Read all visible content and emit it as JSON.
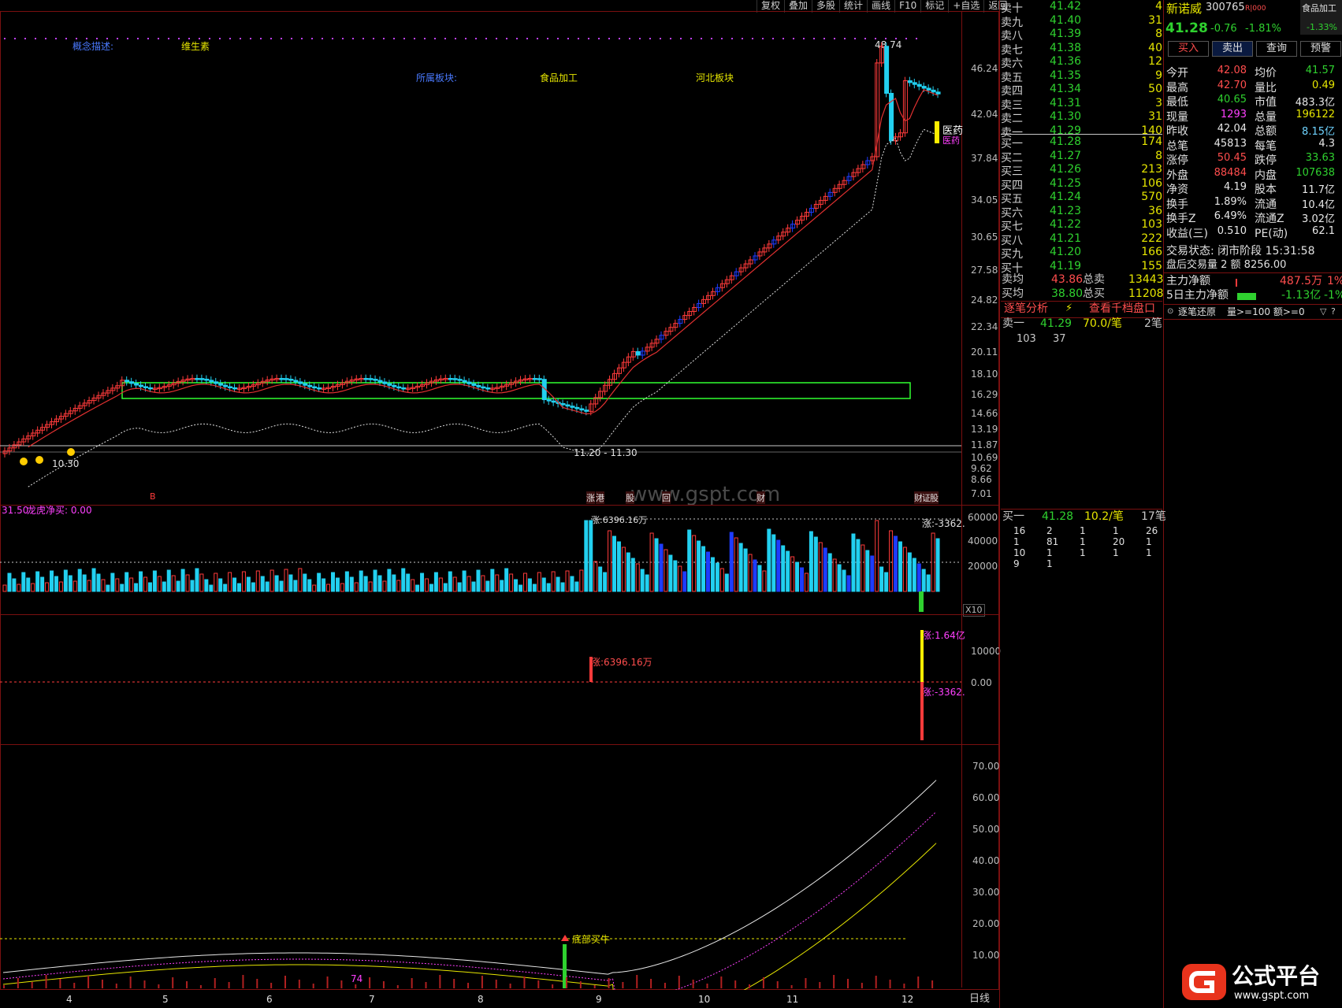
{
  "toolbar": [
    "复权",
    "叠加",
    "多股",
    "统计",
    "画线",
    "F10",
    "标记",
    "+自选",
    "返回"
  ],
  "chart_info": {
    "concept_label": "概念描述:",
    "concept_value": "维生素",
    "sector_label": "所属板块:",
    "sector_value": "食品加工",
    "region_value": "河北板块",
    "peak_label": "48.74",
    "range_label_left": "10.30",
    "range_label_mid": "11.20 - 11.30",
    "tag_medicine": "医药",
    "tag_medicine2": "医药",
    "watermark": "www.gspt.com",
    "event_tags": [
      "B",
      "涨",
      "港",
      "股",
      "回",
      "财",
      "财",
      "证",
      "股"
    ],
    "price_axis": [
      "46.24",
      "42.04",
      "37.84",
      "34.05",
      "30.65",
      "27.58",
      "24.82",
      "22.34",
      "20.11",
      "18.10",
      "16.29",
      "14.66",
      "13.19",
      "11.87",
      "10.69",
      "9.62",
      "8.66",
      "7.01"
    ],
    "vol_header_a": "31.50",
    "vol_header_b": "龙虎净买: 0.00",
    "vol_axis": [
      "60000",
      "40000",
      "20000"
    ],
    "vol_annot_left": "涨:6396.16万",
    "vol_annot_right": "涨:-3362.",
    "x10": "X10",
    "flow_axis": [
      "10000",
      "0.00"
    ],
    "flow_annot_left": "涨:6396.16万",
    "flow_annot_right_top": "涨:1.64亿",
    "flow_annot_right_bottom": "涨:-3362.",
    "ind_axis": [
      "70.00",
      "60.00",
      "50.00",
      "40.00",
      "30.00",
      "20.00",
      "10.00"
    ],
    "ind_signal": "底部买牛",
    "ind_74": "74",
    "date_axis": [
      "4",
      "5",
      "6",
      "7",
      "8",
      "9",
      "10",
      "11",
      "12"
    ],
    "period": "日线"
  },
  "orderbook": {
    "sells": [
      {
        "label": "卖十",
        "price": "41.42",
        "vol": "4"
      },
      {
        "label": "卖九",
        "price": "41.40",
        "vol": "31"
      },
      {
        "label": "卖八",
        "price": "41.39",
        "vol": "8"
      },
      {
        "label": "卖七",
        "price": "41.38",
        "vol": "40"
      },
      {
        "label": "卖六",
        "price": "41.36",
        "vol": "12"
      },
      {
        "label": "卖五",
        "price": "41.35",
        "vol": "9"
      },
      {
        "label": "卖四",
        "price": "41.34",
        "vol": "50"
      },
      {
        "label": "卖三",
        "price": "41.31",
        "vol": "3"
      },
      {
        "label": "卖二",
        "price": "41.30",
        "vol": "31"
      },
      {
        "label": "卖一",
        "price": "41.29",
        "vol": "140"
      }
    ],
    "buys": [
      {
        "label": "买一",
        "price": "41.28",
        "vol": "174"
      },
      {
        "label": "买二",
        "price": "41.27",
        "vol": "8"
      },
      {
        "label": "买三",
        "price": "41.26",
        "vol": "213"
      },
      {
        "label": "买四",
        "price": "41.25",
        "vol": "106"
      },
      {
        "label": "买五",
        "price": "41.24",
        "vol": "570"
      },
      {
        "label": "买六",
        "price": "41.23",
        "vol": "36"
      },
      {
        "label": "买七",
        "price": "41.22",
        "vol": "103"
      },
      {
        "label": "买八",
        "price": "41.21",
        "vol": "222"
      },
      {
        "label": "买九",
        "price": "41.20",
        "vol": "166"
      },
      {
        "label": "买十",
        "price": "41.19",
        "vol": "155"
      }
    ],
    "avg_sell_label": "卖均",
    "avg_sell": "43.86",
    "total_sell_label": "总卖",
    "total_sell": "13443",
    "avg_buy_label": "买均",
    "avg_buy": "38.80",
    "total_buy_label": "总买",
    "total_buy": "11208",
    "tab_analysis": "逐笔分析",
    "tab_depth": "查看千档盘口",
    "sell1_label": "卖一",
    "sell1_price": "41.29",
    "sell1_per": "70.0/笔",
    "sell1_count": "2笔",
    "sell1_items": [
      "103",
      "37"
    ],
    "buy1_label": "买一",
    "buy1_price": "41.28",
    "buy1_per": "10.2/笔",
    "buy1_count": "17笔",
    "buy1_grid": [
      [
        "16",
        "2",
        "1",
        "1",
        "26"
      ],
      [
        "1",
        "81",
        "1",
        "20",
        "1"
      ],
      [
        "10",
        "1",
        "1",
        "1",
        "1"
      ],
      [
        "9",
        "1",
        "",
        "",
        ""
      ]
    ]
  },
  "quote": {
    "name": "新诺威",
    "code": "300765",
    "tag": "R|000",
    "sector_badge": "食品加工",
    "sector_pct": "-1.33%",
    "price": "41.28",
    "change": "-0.76",
    "pct": "-1.81%",
    "buttons": [
      "买入",
      "卖出",
      "查询",
      "预警"
    ],
    "rows": [
      [
        {
          "k": "今开",
          "v": "42.08",
          "c": "red"
        },
        {
          "k": "均价",
          "v": "41.57",
          "c": "green"
        }
      ],
      [
        {
          "k": "最高",
          "v": "42.70",
          "c": "red"
        },
        {
          "k": "量比",
          "v": "0.49",
          "c": "yellow"
        }
      ],
      [
        {
          "k": "最低",
          "v": "40.65",
          "c": "green"
        },
        {
          "k": "市值",
          "v": "483.3亿",
          "c": "white"
        }
      ],
      [
        {
          "k": "现量",
          "v": "1293",
          "c": "mag"
        },
        {
          "k": "总量",
          "v": "196122",
          "c": "yellow"
        }
      ],
      [
        {
          "k": "昨收",
          "v": "42.04",
          "c": "white"
        },
        {
          "k": "总额",
          "v": "8.15亿",
          "c": "cyan"
        }
      ],
      [
        {
          "k": "总笔",
          "v": "45813",
          "c": "white"
        },
        {
          "k": "每笔",
          "v": "4.3",
          "c": "white"
        }
      ],
      [
        {
          "k": "涨停",
          "v": "50.45",
          "c": "red"
        },
        {
          "k": "跌停",
          "v": "33.63",
          "c": "green"
        }
      ],
      [
        {
          "k": "外盘",
          "v": "88484",
          "c": "red"
        },
        {
          "k": "内盘",
          "v": "107638",
          "c": "green"
        }
      ],
      [
        {
          "k": "净资",
          "v": "4.19",
          "c": "white"
        },
        {
          "k": "股本",
          "v": "11.7亿",
          "c": "white"
        }
      ],
      [
        {
          "k": "换手",
          "v": "1.89%",
          "c": "white"
        },
        {
          "k": "流通",
          "v": "10.4亿",
          "c": "white"
        }
      ],
      [
        {
          "k": "换手Z",
          "v": "6.49%",
          "c": "white"
        },
        {
          "k": "流通Z",
          "v": "3.02亿",
          "c": "white"
        }
      ],
      [
        {
          "k": "收益(三)",
          "v": "0.510",
          "c": "white"
        },
        {
          "k": "PE(动)",
          "v": "62.1",
          "c": "white"
        }
      ]
    ],
    "trade_status": "交易状态: 闭市阶段 15:31:58",
    "after_hours": "盘后交易量 2 额 8256.00",
    "main_flow_label": "主力净额",
    "main_flow": "487.5万",
    "main_flow_pct": "1%",
    "main5_label": "5日主力净额",
    "main5": "-1.13亿",
    "main5_pct": "-1%",
    "tick_restore": "逐笔还原",
    "tick_filter": "量>=100 额>=0",
    "logo_text": "公式平台",
    "logo_url": "www.gspt.com"
  },
  "colors": {
    "up": "#ff3b3b",
    "down": "#22d0f0",
    "blue": "#1e3cff",
    "grid": "#7a1010"
  }
}
